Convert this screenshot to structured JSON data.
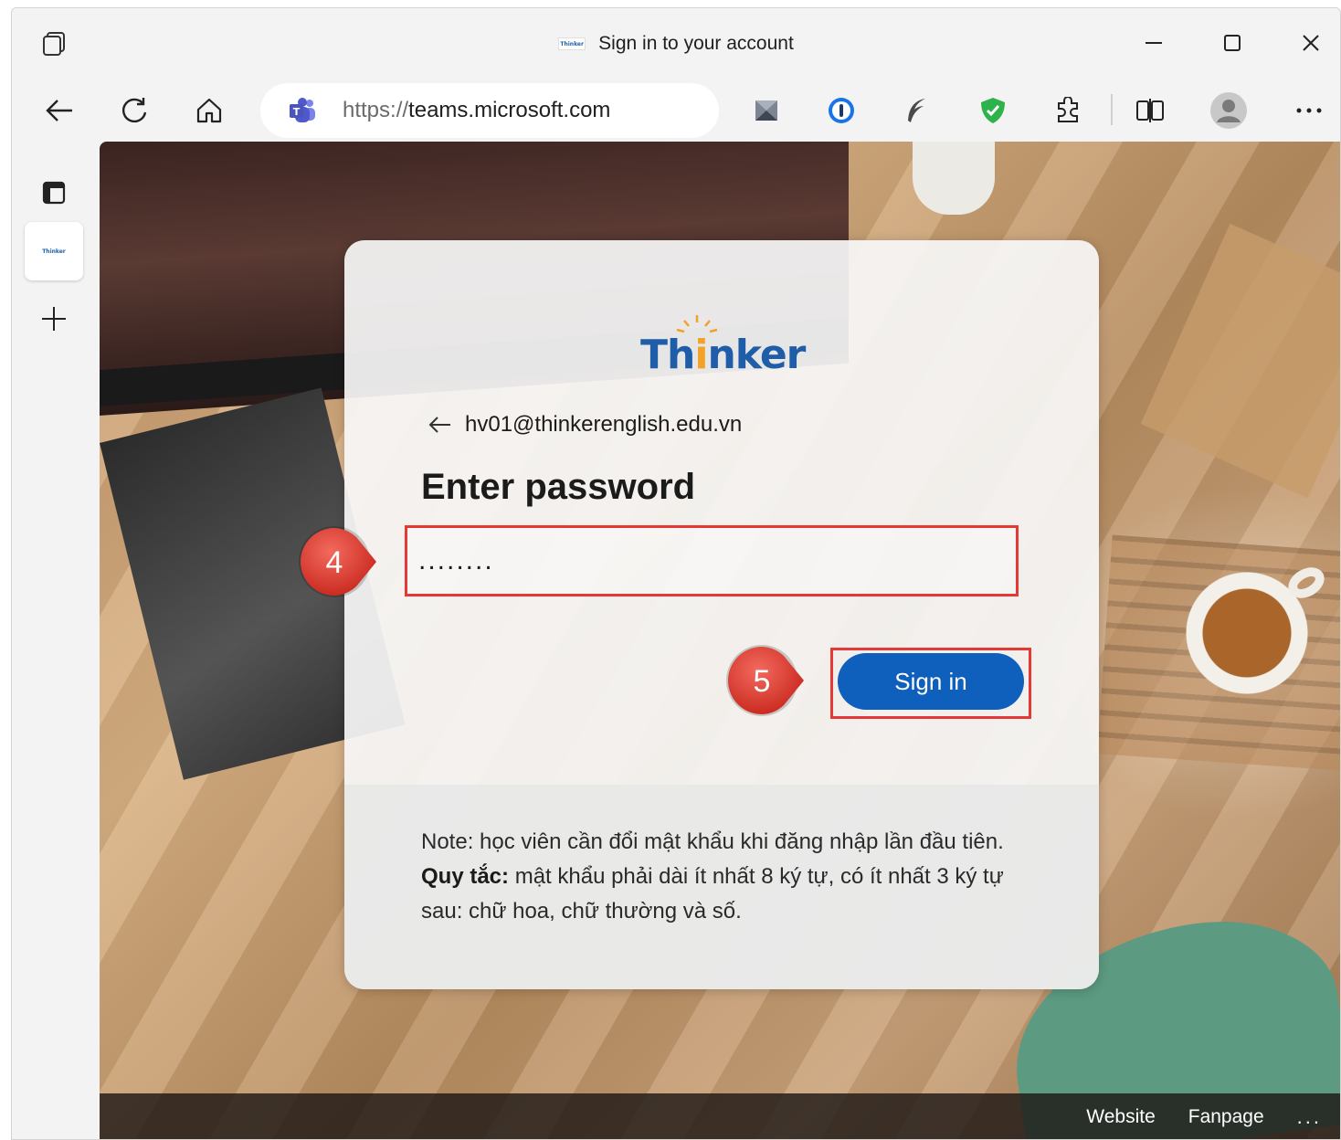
{
  "window": {
    "title": "Sign in to your account",
    "favicon_text": "Thinker"
  },
  "toolbar": {
    "url_scheme": "https://",
    "url_host": "teams.microsoft.com"
  },
  "page": {
    "logo_prefix": "Th",
    "logo_bulb": "i",
    "logo_suffix": "nker",
    "email": "hv01@thinkerenglish.edu.vn",
    "heading": "Enter password",
    "password_value": "........",
    "signin_label": "Sign in",
    "note_part1": "Note: học viên cần đổi mật khẩu khi đăng nhập lần đầu tiên. ",
    "note_bold": "Quy tắc:",
    "note_part2": " mật khẩu phải dài ít nhất 8 ký tự, có ít nhất 3 ký tự sau: chữ hoa, chữ thường và số."
  },
  "annotations": {
    "step_password": "4",
    "step_signin": "5",
    "color": "#e53935"
  },
  "footer": {
    "website": "Website",
    "fanpage": "Fanpage",
    "more": "..."
  },
  "colors": {
    "brand_blue": "#1f5da8",
    "button_blue": "#0f5fbd",
    "highlight_red": "#e53935"
  }
}
